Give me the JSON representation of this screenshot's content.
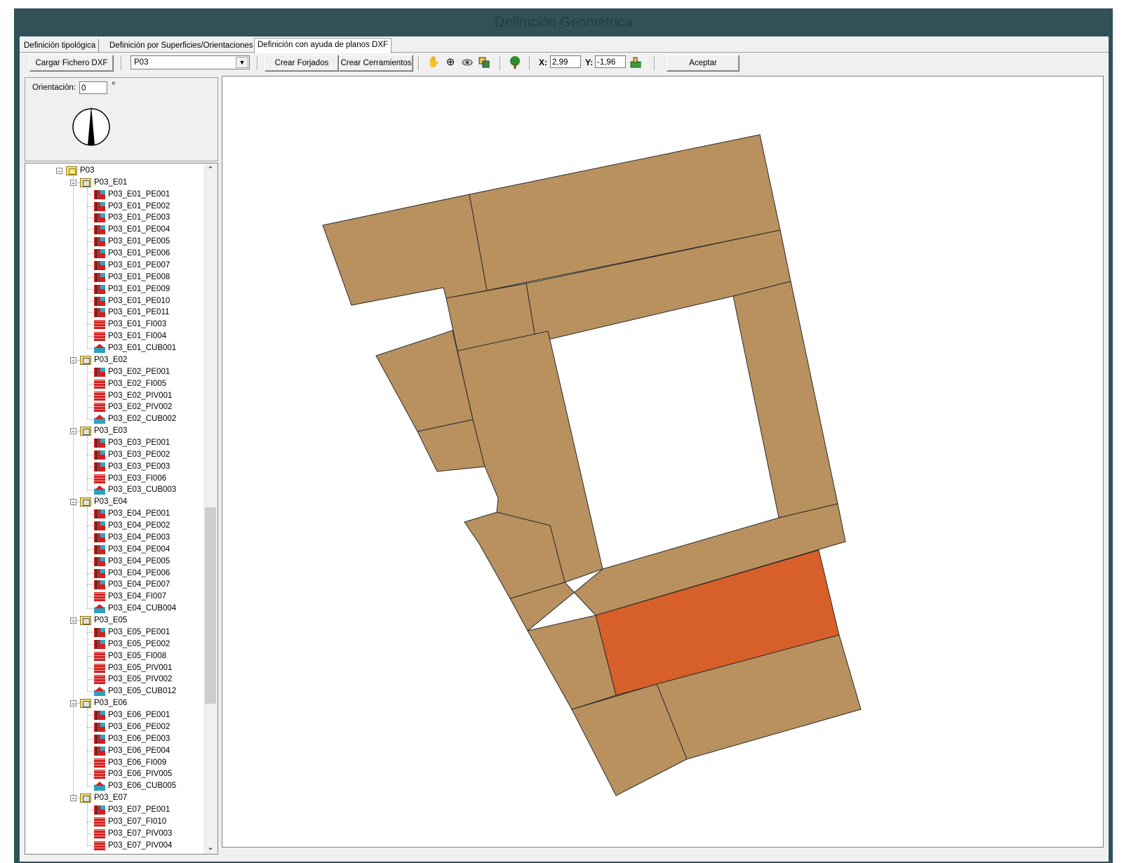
{
  "window": {
    "title": "Definición Geométrica"
  },
  "tabs": [
    {
      "label": "Definición tipológica",
      "active": false
    },
    {
      "label": "Definición por Superficies/Orientaciones",
      "active": false
    },
    {
      "label": "Definición con ayuda de planos DXF",
      "active": true
    }
  ],
  "toolbar": {
    "load_dxf_label": "Cargar Fichero DXF",
    "plant_select_value": "P03",
    "create_slabs_label": "Crear Forjados",
    "create_enclosures_label": "Crear Cerramientos",
    "x_label": "X:",
    "x_value": "2,99",
    "y_label": "Y:",
    "y_value": "-1,96",
    "accept_label": "Aceptar",
    "icons": [
      "pan-hand-icon",
      "zoom-icon",
      "view-icon",
      "layers-icon",
      "tree-icon",
      "apply-coords-icon"
    ]
  },
  "orientation": {
    "label": "Orientación:",
    "value": "0",
    "unit": "º"
  },
  "tree": {
    "root": "P03",
    "levels": [
      {
        "name": "P03_E01",
        "items": [
          {
            "name": "P03_E01_PE001",
            "type": "wall"
          },
          {
            "name": "P03_E01_PE002",
            "type": "wall"
          },
          {
            "name": "P03_E01_PE003",
            "type": "wall"
          },
          {
            "name": "P03_E01_PE004",
            "type": "wall"
          },
          {
            "name": "P03_E01_PE005",
            "type": "wall"
          },
          {
            "name": "P03_E01_PE006",
            "type": "wall"
          },
          {
            "name": "P03_E01_PE007",
            "type": "wall"
          },
          {
            "name": "P03_E01_PE008",
            "type": "wall"
          },
          {
            "name": "P03_E01_PE009",
            "type": "wall"
          },
          {
            "name": "P03_E01_PE010",
            "type": "wall"
          },
          {
            "name": "P03_E01_PE011",
            "type": "wall"
          },
          {
            "name": "P03_E01_FI003",
            "type": "floor"
          },
          {
            "name": "P03_E01_FI004",
            "type": "floor"
          },
          {
            "name": "P03_E01_CUB001",
            "type": "roof"
          }
        ]
      },
      {
        "name": "P03_E02",
        "items": [
          {
            "name": "P03_E02_PE001",
            "type": "wall"
          },
          {
            "name": "P03_E02_FI005",
            "type": "floor"
          },
          {
            "name": "P03_E02_PIV001",
            "type": "floor"
          },
          {
            "name": "P03_E02_PIV002",
            "type": "floor"
          },
          {
            "name": "P03_E02_CUB002",
            "type": "roof"
          }
        ]
      },
      {
        "name": "P03_E03",
        "items": [
          {
            "name": "P03_E03_PE001",
            "type": "wall"
          },
          {
            "name": "P03_E03_PE002",
            "type": "wall"
          },
          {
            "name": "P03_E03_PE003",
            "type": "wall"
          },
          {
            "name": "P03_E03_FI006",
            "type": "floor"
          },
          {
            "name": "P03_E03_CUB003",
            "type": "roof"
          }
        ]
      },
      {
        "name": "P03_E04",
        "items": [
          {
            "name": "P03_E04_PE001",
            "type": "wall"
          },
          {
            "name": "P03_E04_PE002",
            "type": "wall"
          },
          {
            "name": "P03_E04_PE003",
            "type": "wall"
          },
          {
            "name": "P03_E04_PE004",
            "type": "wall"
          },
          {
            "name": "P03_E04_PE005",
            "type": "wall"
          },
          {
            "name": "P03_E04_PE006",
            "type": "wall"
          },
          {
            "name": "P03_E04_PE007",
            "type": "wall"
          },
          {
            "name": "P03_E04_FI007",
            "type": "floor"
          },
          {
            "name": "P03_E04_CUB004",
            "type": "roof"
          }
        ]
      },
      {
        "name": "P03_E05",
        "items": [
          {
            "name": "P03_E05_PE001",
            "type": "wall"
          },
          {
            "name": "P03_E05_PE002",
            "type": "wall"
          },
          {
            "name": "P03_E05_FI008",
            "type": "floor"
          },
          {
            "name": "P03_E05_PIV001",
            "type": "floor"
          },
          {
            "name": "P03_E05_PIV002",
            "type": "floor"
          },
          {
            "name": "P03_E05_CUB012",
            "type": "roof"
          }
        ]
      },
      {
        "name": "P03_E06",
        "items": [
          {
            "name": "P03_E06_PE001",
            "type": "wall"
          },
          {
            "name": "P03_E06_PE002",
            "type": "wall"
          },
          {
            "name": "P03_E06_PE003",
            "type": "wall"
          },
          {
            "name": "P03_E06_PE004",
            "type": "wall"
          },
          {
            "name": "P03_E06_FI009",
            "type": "floor"
          },
          {
            "name": "P03_E06_PIV005",
            "type": "floor"
          },
          {
            "name": "P03_E06_CUB005",
            "type": "roof"
          }
        ]
      },
      {
        "name": "P03_E07",
        "items": [
          {
            "name": "P03_E07_PE001",
            "type": "wall"
          },
          {
            "name": "P03_E07_FI010",
            "type": "floor"
          },
          {
            "name": "P03_E07_PIV003",
            "type": "floor"
          },
          {
            "name": "P03_E07_PIV004",
            "type": "floor"
          }
        ]
      }
    ]
  },
  "plan": {
    "fill_color": "#b8915f",
    "selected_color": "#d75f2a",
    "stroke_color": "#2a2a2a"
  }
}
